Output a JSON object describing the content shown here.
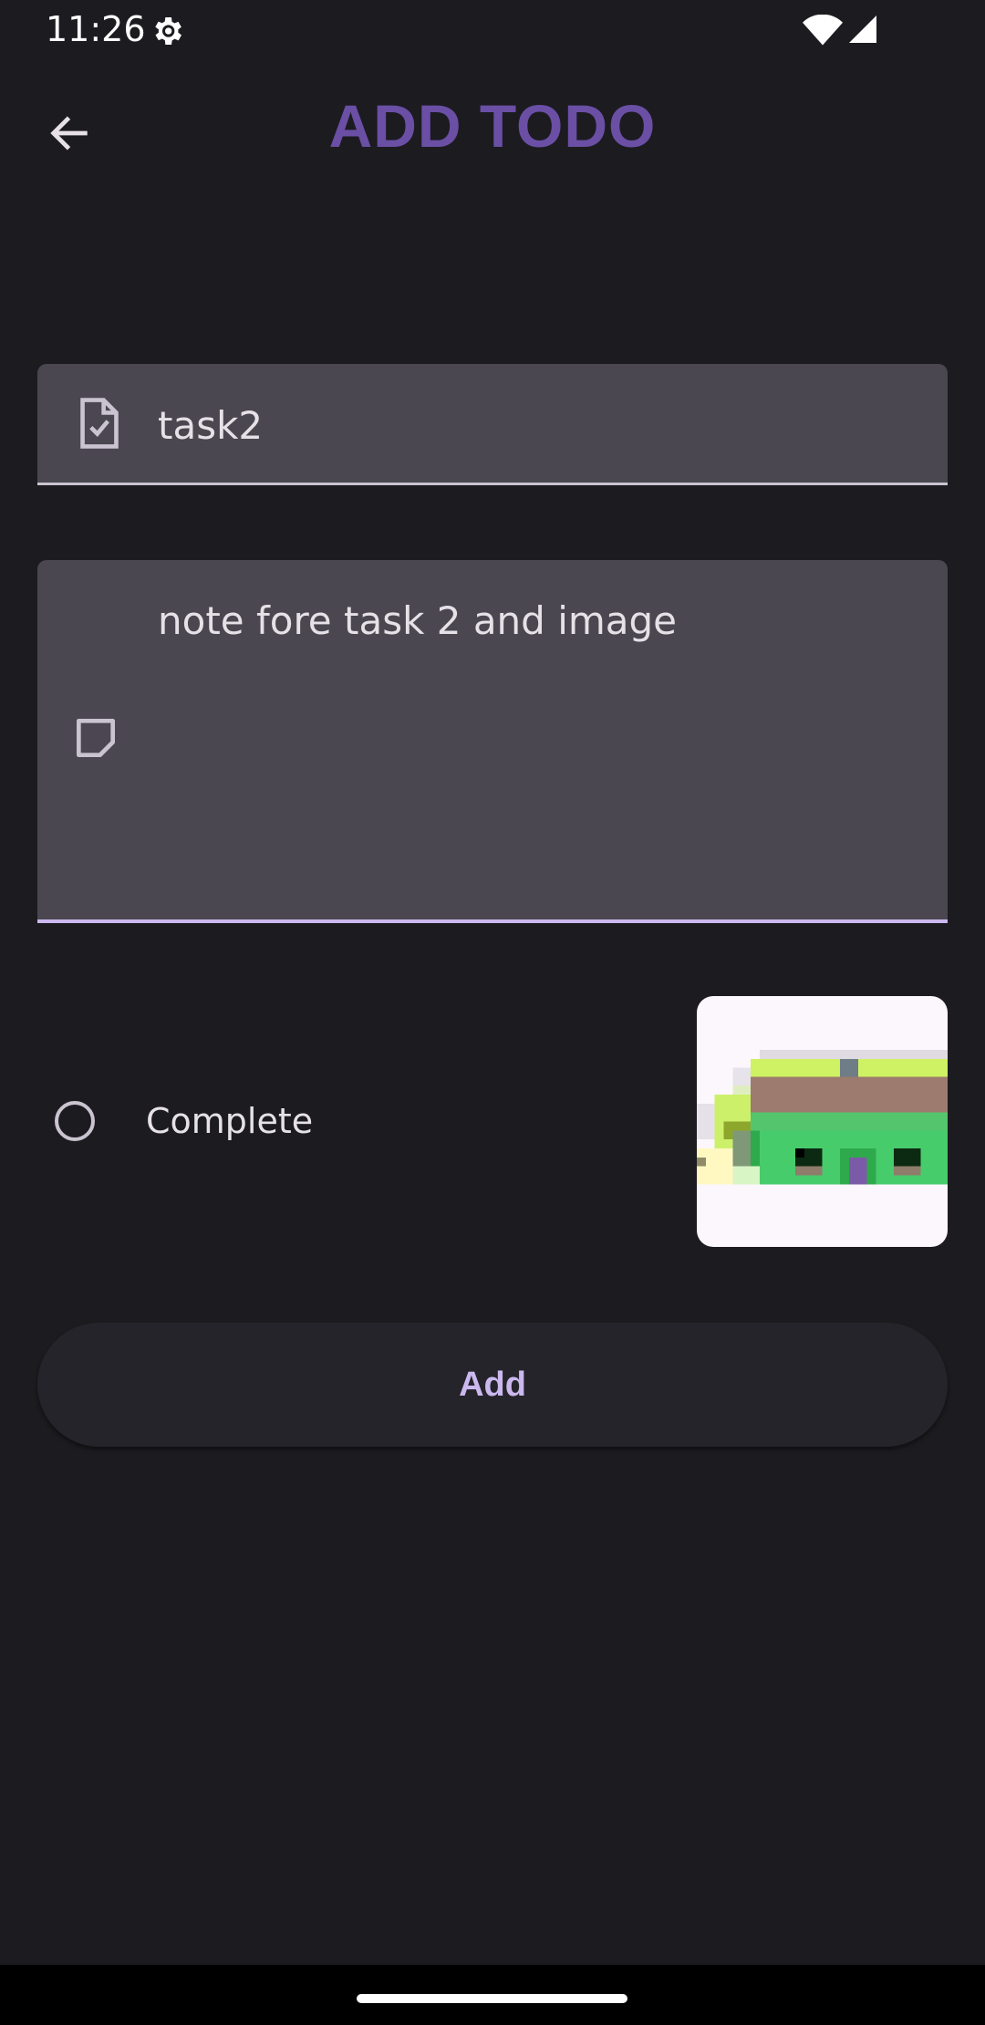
{
  "status_bar": {
    "time": "11:26",
    "icons": [
      "gear-icon",
      "wifi-icon",
      "signal-icon"
    ]
  },
  "app_bar": {
    "title": "ADD TODO",
    "back_icon": "arrow-left-icon",
    "title_color": "#6a4fa5"
  },
  "form": {
    "task_field": {
      "value": "task2",
      "icon": "task-checked-file-icon"
    },
    "note_field": {
      "value": "note fore task 2 and image",
      "icon": "sticky-note-icon"
    },
    "complete": {
      "label": "Complete",
      "checked": false
    },
    "image": {
      "description_icon": "pixel-art-image"
    },
    "add_button": {
      "label": "Add"
    }
  },
  "colors": {
    "background": "#1c1b20",
    "field_background": "#4a4750",
    "accent": "#cbb8ef"
  }
}
